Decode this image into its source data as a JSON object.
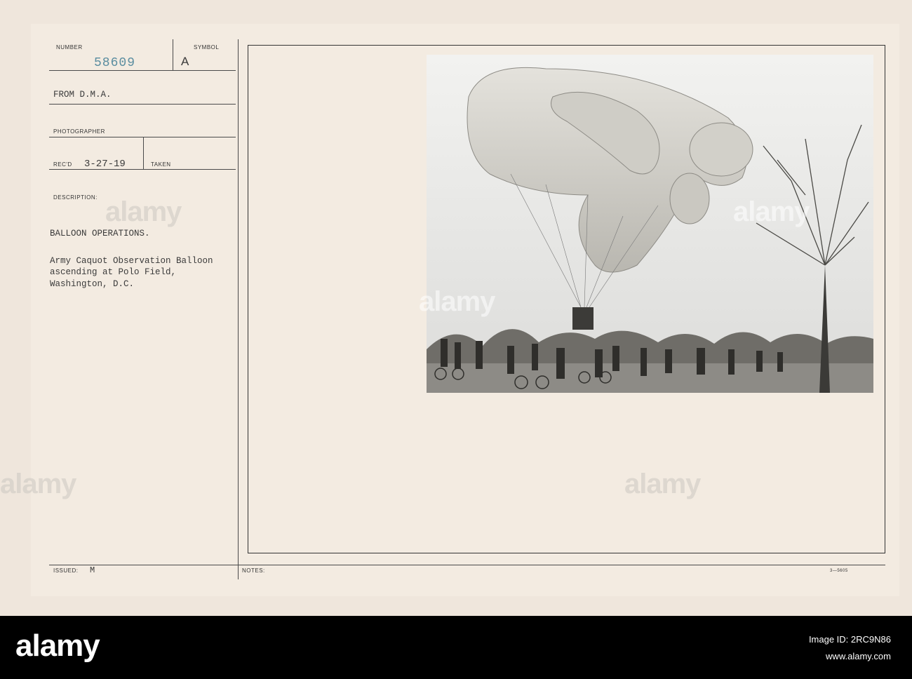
{
  "card": {
    "number_label": "NUMBER",
    "number_value": "58609",
    "symbol_label": "SYMBOL",
    "symbol_value": "A",
    "from_text": "FROM D.M.A.",
    "photographer_label": "PHOTOGRAPHER",
    "recd_label": "REC'D",
    "recd_value": "3-27-19",
    "taken_label": "TAKEN",
    "description_label": "DESCRIPTION:",
    "title": "BALLOON OPERATIONS.",
    "caption_lines": [
      "Army Caquot Observation Balloon",
      "ascending at Polo Field,",
      "Washington, D.C."
    ],
    "issued_label": "ISSUED:",
    "issued_value": "M",
    "notes_label": "NOTES:",
    "form_code": "3—5605"
  },
  "watermark": {
    "text": "alamy"
  },
  "footer": {
    "logo": "alamy",
    "image_id_label": "Image ID: 2RC9N86",
    "url": "www.alamy.com"
  }
}
